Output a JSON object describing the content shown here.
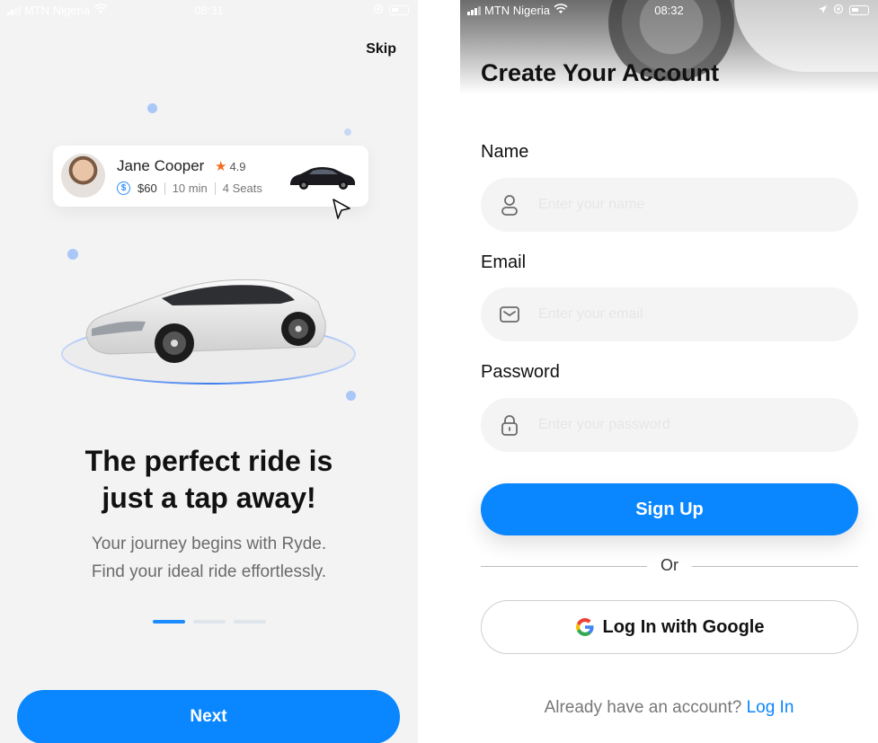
{
  "onboarding": {
    "status": {
      "carrier": "MTN Nigeria",
      "time": "08:31"
    },
    "skip_label": "Skip",
    "ride_card": {
      "driver_name": "Jane Cooper",
      "rating": "4.9",
      "price": "$60",
      "duration": "10 min",
      "seats": "4 Seats"
    },
    "headline_line1": "The perfect ride is",
    "headline_line2": "just a tap away!",
    "sub_line1": "Your journey begins with Ryde.",
    "sub_line2": "Find your ideal ride effortlessly.",
    "pager": {
      "total": 3,
      "active_index": 0
    },
    "next_label": "Next"
  },
  "signup": {
    "status": {
      "carrier": "MTN Nigeria",
      "time": "08:32"
    },
    "title": "Create Your Account",
    "fields": {
      "name": {
        "label": "Name",
        "placeholder": "Enter your name",
        "icon": "person-icon"
      },
      "email": {
        "label": "Email",
        "placeholder": "Enter your email",
        "icon": "mail-icon"
      },
      "password": {
        "label": "Password",
        "placeholder": "Enter your password",
        "icon": "lock-icon"
      }
    },
    "signup_label": "Sign Up",
    "or_label": "Or",
    "google_label": "Log In with Google",
    "have_account_text": "Already have an account?",
    "login_link": "Log In",
    "colors": {
      "primary": "#0a86ff",
      "field_bg": "#f4f4f4"
    }
  }
}
